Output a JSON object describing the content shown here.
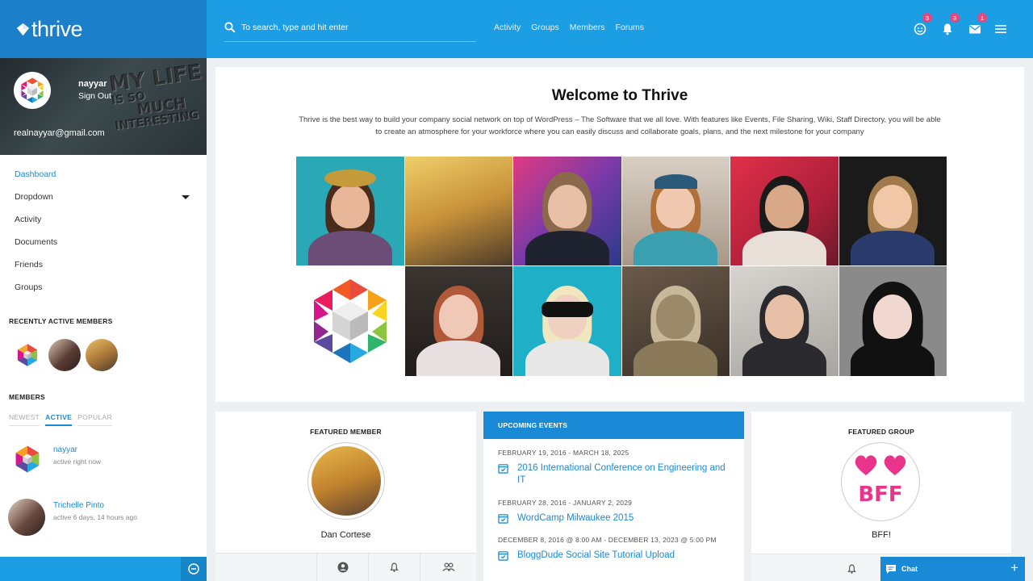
{
  "brand": {
    "name": "thrive"
  },
  "user": {
    "name": "nayyar",
    "sign_out": "Sign Out",
    "email": "realnayyar@gmail.com",
    "cover_text": [
      "MY",
      "LIFE",
      "IS SO",
      "MUCH",
      "INTERESTING"
    ]
  },
  "sidebar": {
    "items": [
      {
        "label": "Dashboard",
        "active": true
      },
      {
        "label": "Dropdown"
      },
      {
        "label": "Activity"
      },
      {
        "label": "Documents"
      },
      {
        "label": "Friends"
      },
      {
        "label": "Groups"
      }
    ],
    "recent_title": "RECENTLY ACTIVE MEMBERS",
    "members_title": "MEMBERS",
    "member_tabs": [
      "NEWEST",
      "ACTIVE",
      "POPULAR"
    ],
    "members": [
      {
        "name": "nayyar",
        "status": "active right now"
      },
      {
        "name": "Trichelle Pinto",
        "status": "active 6 days, 14 hours ago"
      }
    ]
  },
  "topbar": {
    "search_placeholder": "To search, type and hit enter",
    "nav": [
      "Activity",
      "Groups",
      "Members",
      "Forums"
    ],
    "badges": {
      "friends": "3",
      "notifications": "3",
      "messages": "1"
    }
  },
  "welcome": {
    "title": "Welcome to Thrive",
    "text": "Thrive is the best way to build your company social network on top of WordPress – The Software that we all love. With features like Events, File Sharing, Wiki, Staff Directory, you will be able to create an atmosphere for your workforce where you can easily discuss and collaborate goals, plans, and the next milestone for your company"
  },
  "featured_member": {
    "title": "FEATURED MEMBER",
    "name": "Dan Cortese"
  },
  "events": {
    "title": "UPCOMING EVENTS",
    "items": [
      {
        "date": "FEBRUARY 19, 2016 - MARCH 18, 2025",
        "title": "2016 International Conference on Engineering and IT"
      },
      {
        "date": "FEBRUARY 28, 2016 - JANUARY 2, 2029",
        "title": "WordCamp Milwaukee 2015"
      },
      {
        "date": "DECEMBER 8, 2016 @ 8:00 AM - DECEMBER 13, 2023 @ 5:00 PM",
        "title": "BloggDude Social Site Tutorial Upload"
      }
    ]
  },
  "featured_group": {
    "title": "FEATURED GROUP",
    "name": "BFF!",
    "logo_text": "BFF"
  },
  "chat": {
    "label": "Chat"
  },
  "colors": {
    "primary": "#1b9ee3",
    "brand_dark": "#1b80c9",
    "link": "#1b8ad6",
    "badge": "#e8457d"
  }
}
